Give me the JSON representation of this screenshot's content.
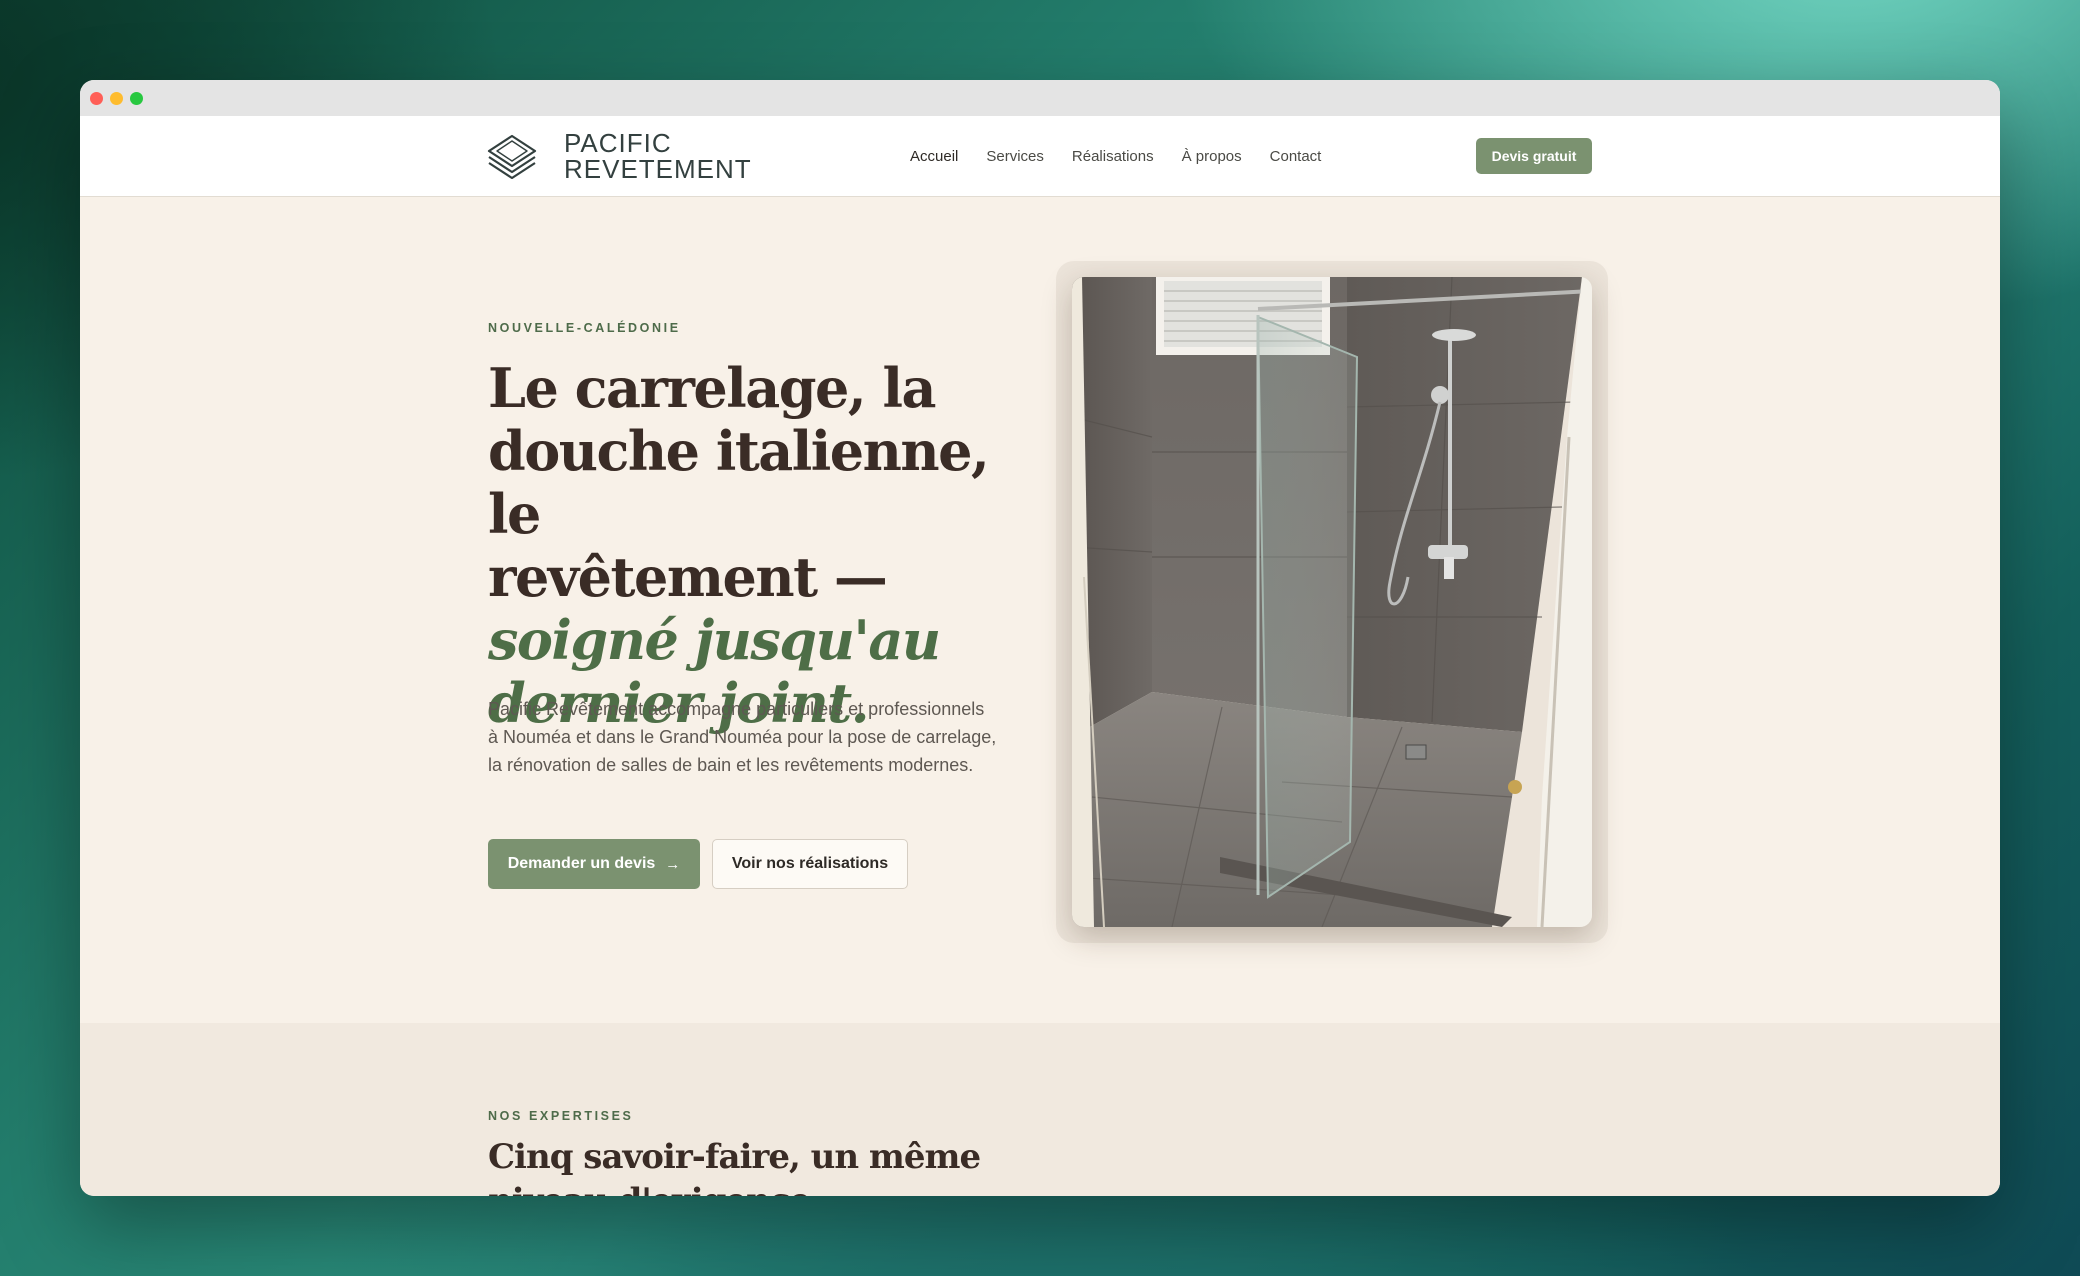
{
  "brand": {
    "name_line1": "PACIFIC",
    "name_line2": "REVETEMENT",
    "logo_icon": "layered-tiles-icon"
  },
  "nav": {
    "links": [
      "Accueil",
      "Services",
      "Réalisations",
      "À propos",
      "Contact"
    ],
    "active": "Accueil",
    "cta": "Devis gratuit"
  },
  "hero": {
    "eyebrow": "NOUVELLE-CALÉDONIE",
    "headline_lines": [
      "Le carrelage, la",
      "douche italienne, le",
      "revêtement —"
    ],
    "headline_accent_lines": [
      "soigné jusqu'au",
      "dernier joint."
    ],
    "description": "Pacific Revêtement accompagne particuliers et professionnels à Nouméa et dans le Grand Nouméa pour la pose de carrelage, la rénovation de salles de bain et les revêtements modernes.",
    "primary_cta": "Demander un devis",
    "primary_cta_icon": "arrow-right-icon",
    "secondary_cta": "Voir nos réalisations",
    "photo_subject": "walk-in-shower-photo"
  },
  "expertise": {
    "eyebrow": "NOS EXPERTISES",
    "title": "Cinq savoir-faire, un même niveau d'exigence."
  },
  "colors": {
    "accent_green": "#7b9270",
    "headline_brown": "#3a2c26",
    "accent_italic": "#4e6e47",
    "hero_bg": "#f8f1e8",
    "section_bg": "#f1e9df"
  }
}
